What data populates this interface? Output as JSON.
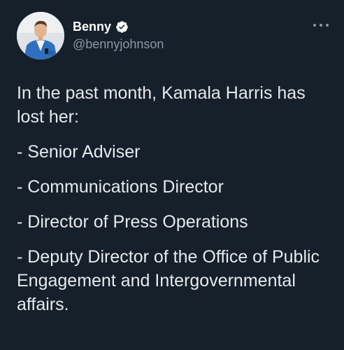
{
  "tweet": {
    "author": {
      "display_name": "Benny",
      "handle": "@bennyjohnson",
      "verified": true
    },
    "more_icon": "more-horizontal-icon",
    "text_intro": "In the past month, Kamala Harris has lost her:",
    "list": [
      "- Senior Adviser",
      "- Communications Director",
      "- Director of Press Operations",
      "- Deputy Director of the Office of Public Engagement and Intergovernmental affairs."
    ]
  },
  "colors": {
    "background": "#15202b",
    "text": "#e7e9ea",
    "secondary": "#8b98a5",
    "verified_badge": "#ffffff"
  }
}
